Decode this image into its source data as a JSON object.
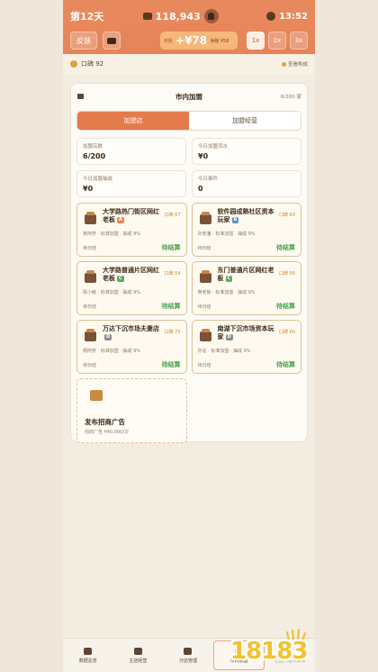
{
  "header": {
    "day": "第12天",
    "money": "118,943",
    "time": "13:52",
    "feedback_label": "反馈",
    "income_prefix": "到账",
    "income_value": "+¥78",
    "income_net": "净赚 ¥58",
    "speeds": [
      "1x",
      "2x",
      "3x"
    ],
    "active_speed": "1x"
  },
  "subbar": {
    "reputation": "口碑 92",
    "tip": "查看构成"
  },
  "panel": {
    "title": "市内加盟",
    "count": "6/200 家",
    "tabs": [
      "加盟店",
      "加盟经营"
    ],
    "active_tab": "加盟店",
    "stats": [
      {
        "label": "加盟店数",
        "value": "6/200"
      },
      {
        "label": "今日加盟流水",
        "value": "¥0"
      },
      {
        "label": "今日加盟抽成",
        "value": "¥0"
      },
      {
        "label": "今日事件",
        "value": "0"
      }
    ],
    "shops": [
      {
        "name": "大学路热门街区网红老板",
        "grade": "A",
        "grade_color": "#e8874f",
        "reputation": "口碑 67",
        "sub": "吴阿芳 · 标准加盟 · 抽成 9%",
        "pending": "待日结",
        "settle": "待结算"
      },
      {
        "name": "软件园成熟社区资本玩家",
        "grade": "B",
        "grade_color": "#5b8fd6",
        "reputation": "口碑 63",
        "sub": "孙老潘 · 标准加盟 · 抽成 9%",
        "pending": "待日结",
        "settle": "待结算"
      },
      {
        "name": "大学路普通片区网红老板",
        "grade": "C",
        "grade_color": "#5aa85f",
        "reputation": "口碑 54",
        "sub": "陈小敏 · 标准加盟 · 抽成 9%",
        "pending": "待日结",
        "settle": "待结算"
      },
      {
        "name": "东门普通片区网红老板",
        "grade": "C",
        "grade_color": "#5aa85f",
        "reputation": "口碑 56",
        "sub": "黄老板 · 标准加盟 · 抽成 9%",
        "pending": "待日结",
        "settle": "待结算"
      },
      {
        "name": "万达下沉市场夫妻店",
        "grade": "D",
        "grade_color": "#8d8d8d",
        "reputation": "口碑 75",
        "sub": "杨阿芳 · 标准加盟 · 抽成 9%",
        "pending": "待日结",
        "settle": "待结算"
      },
      {
        "name": "南湖下沉市场资本玩家",
        "grade": "D",
        "grade_color": "#8d8d8d",
        "reputation": "口碑 60",
        "sub": "孙总 · 标准加盟 · 抽成 9%",
        "pending": "待日结",
        "settle": "待结算"
      }
    ],
    "ad": {
      "title": "发布招商广告",
      "sub": "招商广告 ¥40,000/次"
    }
  },
  "nav": [
    {
      "label": "数据总览"
    },
    {
      "label": "主店经营"
    },
    {
      "label": "分店管理"
    },
    {
      "label": "市内加盟"
    },
    {
      "label": "全国代理未解锁"
    }
  ],
  "active_nav": "市内加盟",
  "watermark": "18183",
  "colors": {
    "accent": "#e47b4d",
    "settle_green": "#4aa050",
    "reputation_gold": "#c9892f"
  }
}
